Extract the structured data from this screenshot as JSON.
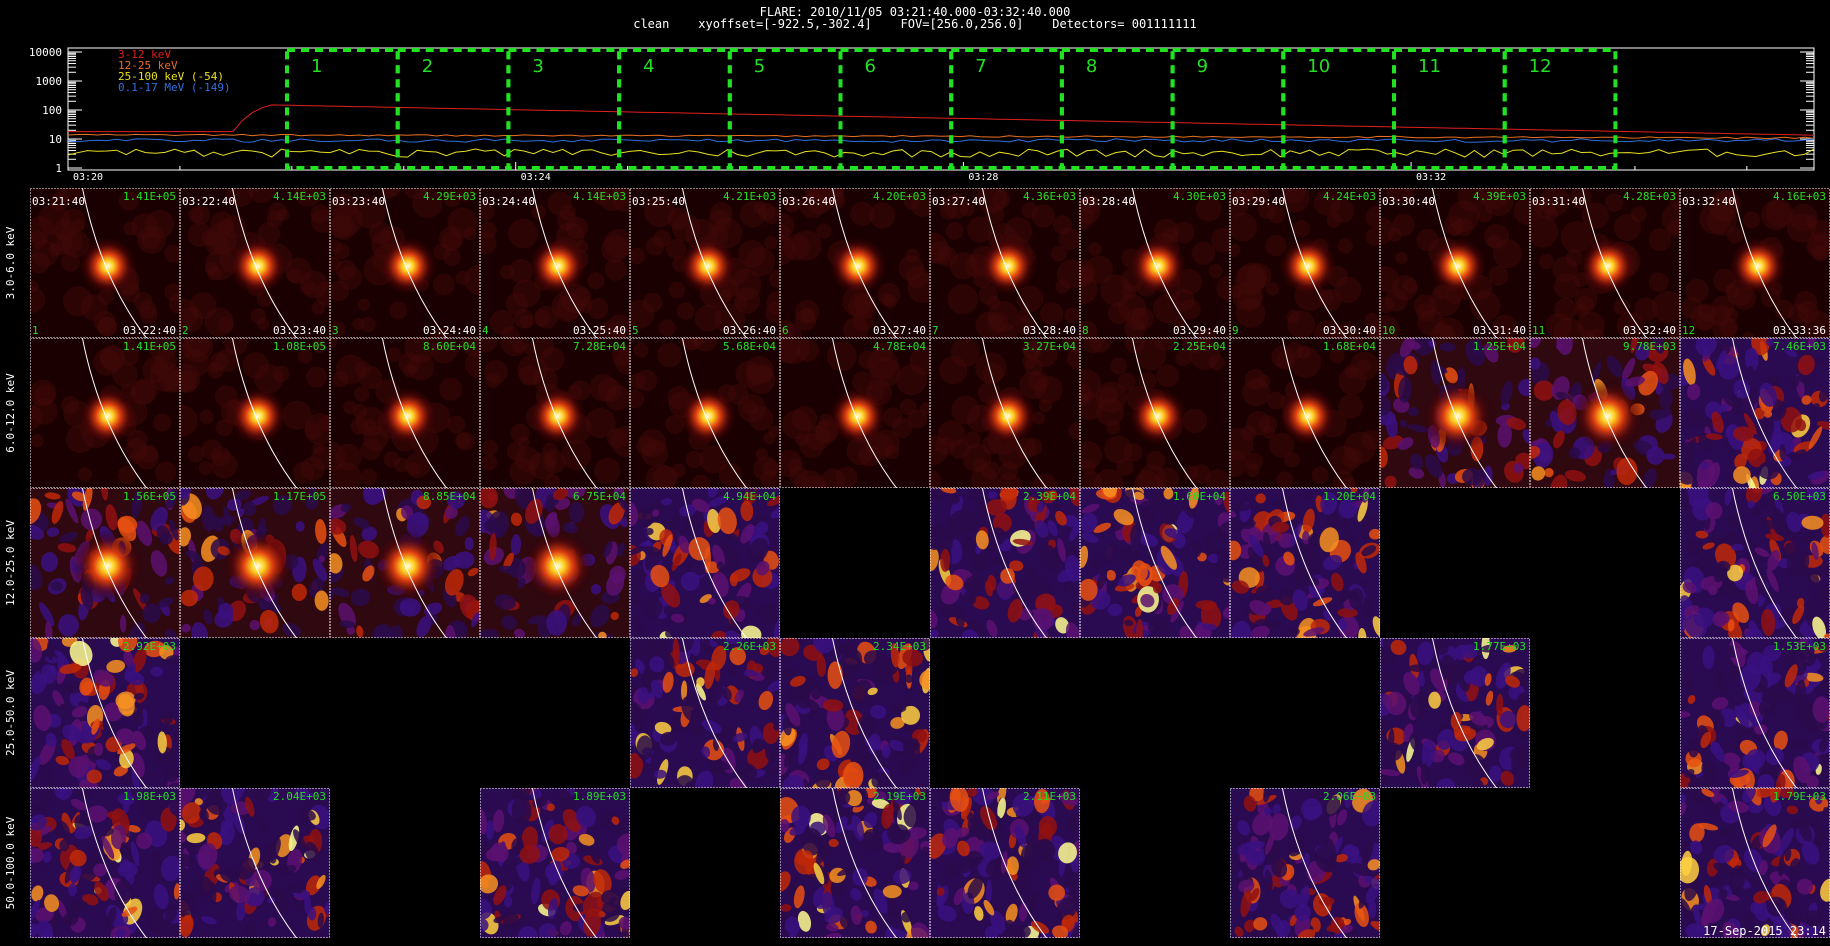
{
  "header": {
    "title": "FLARE: 2010/11/05 03:21:40.000-03:32:40.000",
    "subtitle": "clean    xyoffset=[-922.5,-302.4]    FOV=[256.0,256.0]    Detectors= 001111111"
  },
  "lightcurve": {
    "legend": [
      {
        "label": "3-12 keV",
        "color": "#e02020"
      },
      {
        "label": "12-25 keV",
        "color": "#e87020"
      },
      {
        "label": "25-100 keV (-54)",
        "color": "#e8e020"
      },
      {
        "label": "0.1-17 MeV (-149)",
        "color": "#3070e0"
      }
    ],
    "y_ticks": [
      "10000",
      "1000",
      "100",
      "10",
      "1"
    ],
    "x_ticks": [
      "03:20",
      "03:24",
      "03:28",
      "03:32"
    ],
    "interval_labels": [
      "1",
      "2",
      "3",
      "4",
      "5",
      "6",
      "7",
      "8",
      "9",
      "10",
      "11",
      "12"
    ],
    "box_color": "#22e022"
  },
  "rows": [
    {
      "label": "3.0-6.0 keV",
      "show_text": true,
      "cells": [
        {
          "present": true,
          "peak": "1.41E+05",
          "start": "03:21:40",
          "end": "03:22:40",
          "idx": "1",
          "style": "point",
          "bright": 1.0
        },
        {
          "present": true,
          "peak": "4.14E+03",
          "start": "03:22:40",
          "end": "03:23:40",
          "idx": "2",
          "style": "point",
          "bright": 1.0
        },
        {
          "present": true,
          "peak": "4.29E+03",
          "start": "03:23:40",
          "end": "03:24:40",
          "idx": "3",
          "style": "point",
          "bright": 1.0
        },
        {
          "present": true,
          "peak": "4.14E+03",
          "start": "03:24:40",
          "end": "03:25:40",
          "idx": "4",
          "style": "point",
          "bright": 1.0
        },
        {
          "present": true,
          "peak": "4.21E+03",
          "start": "03:25:40",
          "end": "03:26:40",
          "idx": "5",
          "style": "point",
          "bright": 1.0
        },
        {
          "present": true,
          "peak": "4.20E+03",
          "start": "03:26:40",
          "end": "03:27:40",
          "idx": "6",
          "style": "point",
          "bright": 1.0
        },
        {
          "present": true,
          "peak": "4.36E+03",
          "start": "03:27:40",
          "end": "03:28:40",
          "idx": "7",
          "style": "point",
          "bright": 1.0
        },
        {
          "present": true,
          "peak": "4.30E+03",
          "start": "03:28:40",
          "end": "03:29:40",
          "idx": "8",
          "style": "point",
          "bright": 1.0
        },
        {
          "present": true,
          "peak": "4.24E+03",
          "start": "03:29:40",
          "end": "03:30:40",
          "idx": "9",
          "style": "point",
          "bright": 1.0
        },
        {
          "present": true,
          "peak": "4.39E+03",
          "start": "03:30:40",
          "end": "03:31:40",
          "idx": "10",
          "style": "point",
          "bright": 1.0
        },
        {
          "present": true,
          "peak": "4.28E+03",
          "start": "03:31:40",
          "end": "03:32:40",
          "idx": "11",
          "style": "point",
          "bright": 1.0
        },
        {
          "present": true,
          "peak": "4.16E+03",
          "start": "03:32:40",
          "end": "03:33:36",
          "idx": "12",
          "style": "point",
          "bright": 1.0
        }
      ]
    },
    {
      "label": "6.0-12.0 keV",
      "show_text": false,
      "cells": [
        {
          "present": true,
          "peak": "1.41E+05",
          "style": "point",
          "bright": 1.0
        },
        {
          "present": true,
          "peak": "1.08E+05",
          "style": "point",
          "bright": 1.0
        },
        {
          "present": true,
          "peak": "8.60E+04",
          "style": "point",
          "bright": 1.0
        },
        {
          "present": true,
          "peak": "7.28E+04",
          "style": "point",
          "bright": 1.0
        },
        {
          "present": true,
          "peak": "5.68E+04",
          "style": "point",
          "bright": 1.0
        },
        {
          "present": true,
          "peak": "4.78E+04",
          "style": "point",
          "bright": 1.0
        },
        {
          "present": true,
          "peak": "3.27E+04",
          "style": "point",
          "bright": 1.0
        },
        {
          "present": true,
          "peak": "2.25E+04",
          "style": "point",
          "bright": 0.9
        },
        {
          "present": true,
          "peak": "1.68E+04",
          "style": "point",
          "bright": 0.8
        },
        {
          "present": true,
          "peak": "1.25E+04",
          "style": "mixed",
          "bright": 0.8
        },
        {
          "present": true,
          "peak": "9.78E+03",
          "style": "mixed",
          "bright": 0.7
        },
        {
          "present": true,
          "peak": "7.46E+03",
          "style": "noise",
          "bright": 0.7
        }
      ]
    },
    {
      "label": "12.0-25.0 keV",
      "show_text": false,
      "cells": [
        {
          "present": true,
          "peak": "1.56E+05",
          "style": "mixed",
          "bright": 0.7
        },
        {
          "present": true,
          "peak": "1.17E+05",
          "style": "mixed",
          "bright": 0.7
        },
        {
          "present": true,
          "peak": "8.85E+04",
          "style": "mixed",
          "bright": 0.7
        },
        {
          "present": true,
          "peak": "6.75E+04",
          "style": "mixed",
          "bright": 0.7
        },
        {
          "present": true,
          "peak": "4.94E+04",
          "style": "noise",
          "bright": 0.7
        },
        {
          "present": false
        },
        {
          "present": true,
          "peak": "2.39E+04",
          "style": "noise",
          "bright": 0.7
        },
        {
          "present": true,
          "peak": "1.60E+04",
          "style": "noise",
          "bright": 0.7
        },
        {
          "present": true,
          "peak": "1.20E+04",
          "style": "noise",
          "bright": 0.7
        },
        {
          "present": false
        },
        {
          "present": false
        },
        {
          "present": true,
          "peak": "6.50E+03",
          "style": "noise",
          "bright": 0.7
        }
      ]
    },
    {
      "label": "25.0-50.0 keV",
      "show_text": false,
      "cells": [
        {
          "present": true,
          "peak": "2.92E+03",
          "style": "noise",
          "bright": 0.6
        },
        {
          "present": false
        },
        {
          "present": false
        },
        {
          "present": false
        },
        {
          "present": true,
          "peak": "2.26E+03",
          "style": "noise",
          "bright": 0.6
        },
        {
          "present": true,
          "peak": "2.34E+03",
          "style": "noise",
          "bright": 0.6
        },
        {
          "present": false
        },
        {
          "present": false
        },
        {
          "present": false
        },
        {
          "present": true,
          "peak": "1.77E+03",
          "style": "noise",
          "bright": 0.6
        },
        {
          "present": false
        },
        {
          "present": true,
          "peak": "1.53E+03",
          "style": "noise",
          "bright": 0.6
        }
      ]
    },
    {
      "label": "50.0-100.0 keV",
      "show_text": false,
      "cells": [
        {
          "present": true,
          "peak": "1.98E+03",
          "style": "noise",
          "bright": 0.6
        },
        {
          "present": true,
          "peak": "2.04E+03",
          "style": "noise",
          "bright": 0.6
        },
        {
          "present": false
        },
        {
          "present": true,
          "peak": "1.89E+03",
          "style": "noise",
          "bright": 0.6
        },
        {
          "present": false
        },
        {
          "present": true,
          "peak": "2.19E+03",
          "style": "noise",
          "bright": 0.6
        },
        {
          "present": true,
          "peak": "2.11E+03",
          "style": "noise",
          "bright": 0.6
        },
        {
          "present": false
        },
        {
          "present": true,
          "peak": "2.06E+03",
          "style": "noise",
          "bright": 0.6
        },
        {
          "present": false
        },
        {
          "present": false
        },
        {
          "present": true,
          "peak": "1.79E+03",
          "style": "noise",
          "bright": 0.6
        }
      ]
    }
  ],
  "footer": "17-Sep-2015 23:14"
}
